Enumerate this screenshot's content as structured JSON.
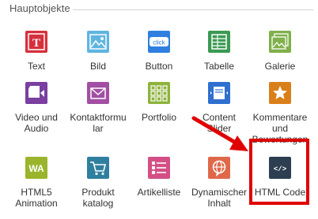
{
  "panel": {
    "title": "Hauptobjekte"
  },
  "tiles": [
    {
      "label": "Text",
      "icon": "text-icon",
      "color": "#d6303c"
    },
    {
      "label": "Bild",
      "icon": "image-icon",
      "color": "#5fb5e0"
    },
    {
      "label": "Button",
      "icon": "click-button-icon",
      "color": "#2f7fe0",
      "icon_text": "click"
    },
    {
      "label": "Tabelle",
      "icon": "table-icon",
      "color": "#3b9a52"
    },
    {
      "label": "Galerie",
      "icon": "gallery-icon",
      "color": "#7fb04a"
    },
    {
      "label": "Video und Audio",
      "icon": "video-audio-icon",
      "color": "#7a3fa0"
    },
    {
      "label": "Kontaktformular",
      "icon": "mail-icon",
      "color": "#a24fa3"
    },
    {
      "label": "Portfolio",
      "icon": "portfolio-icon",
      "color": "#8db33c"
    },
    {
      "label": "Content Slider",
      "icon": "content-slider-icon",
      "color": "#2f6fd0"
    },
    {
      "label": "Kommentare und Bewertungen",
      "icon": "star-comment-icon",
      "color": "#d97f1a"
    },
    {
      "label": "HTML5 Animation",
      "icon": "html5-animation-icon",
      "color": "#9ab52c",
      "icon_text": "WA"
    },
    {
      "label": "Produkt katalog",
      "icon": "shopping-cart-icon",
      "color": "#2f7f9f"
    },
    {
      "label": "Artikelliste",
      "icon": "article-list-icon",
      "color": "#d44f86"
    },
    {
      "label": "Dynamischer Inhalt",
      "icon": "dynamic-content-icon",
      "color": "#e0684a"
    },
    {
      "label": "HTML Code",
      "icon": "html-code-icon",
      "color": "#2c3e50",
      "icon_text": "</>"
    }
  ],
  "annotation": {
    "color": "#e00000"
  }
}
